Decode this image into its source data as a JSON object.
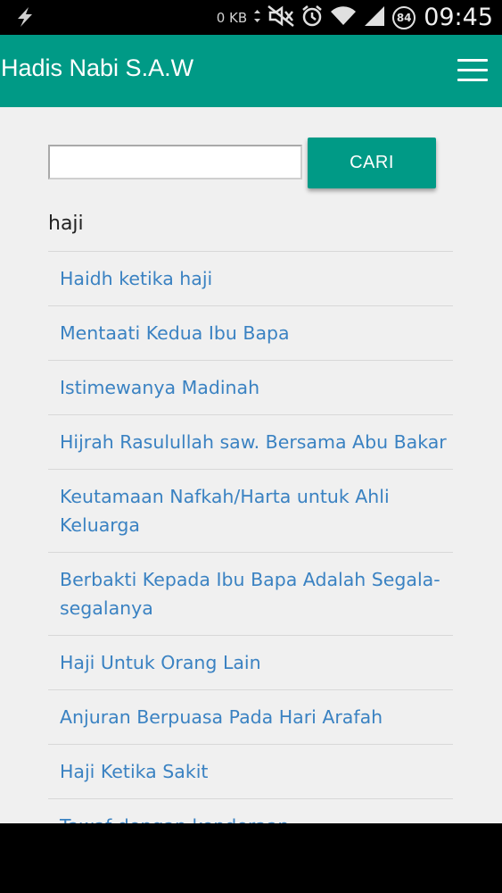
{
  "status_bar": {
    "data_usage": "0 KB",
    "battery_level": "84",
    "time": "09:45",
    "icons": [
      "flash-icon",
      "network-arrows-icon",
      "mute-icon",
      "alarm-icon",
      "wifi-icon",
      "signal-icon",
      "battery-icon"
    ]
  },
  "app_bar": {
    "title": "Hadis Nabi S.A.W",
    "menu_icon": "hamburger-menu-icon",
    "color": "#009a86"
  },
  "search": {
    "input_value": "",
    "button_label": "CARI"
  },
  "query_label": "haji",
  "results": [
    {
      "title": "Haidh ketika haji"
    },
    {
      "title": "Mentaati Kedua Ibu Bapa"
    },
    {
      "title": "Istimewanya Madinah"
    },
    {
      "title": "Hijrah Rasulullah saw. Bersama Abu Bakar"
    },
    {
      "title": "Keutamaan Nafkah/Harta untuk Ahli Keluarga"
    },
    {
      "title": "Berbakti Kepada Ibu Bapa Adalah Segala-segalanya"
    },
    {
      "title": "Haji Untuk Orang Lain"
    },
    {
      "title": "Anjuran Berpuasa Pada Hari Arafah"
    },
    {
      "title": "Haji Ketika Sakit"
    },
    {
      "title": "Tawaf dengan kenderaan"
    }
  ],
  "colors": {
    "accent": "#009a86",
    "link": "#3a82c2",
    "background": "#f0f0f0"
  }
}
